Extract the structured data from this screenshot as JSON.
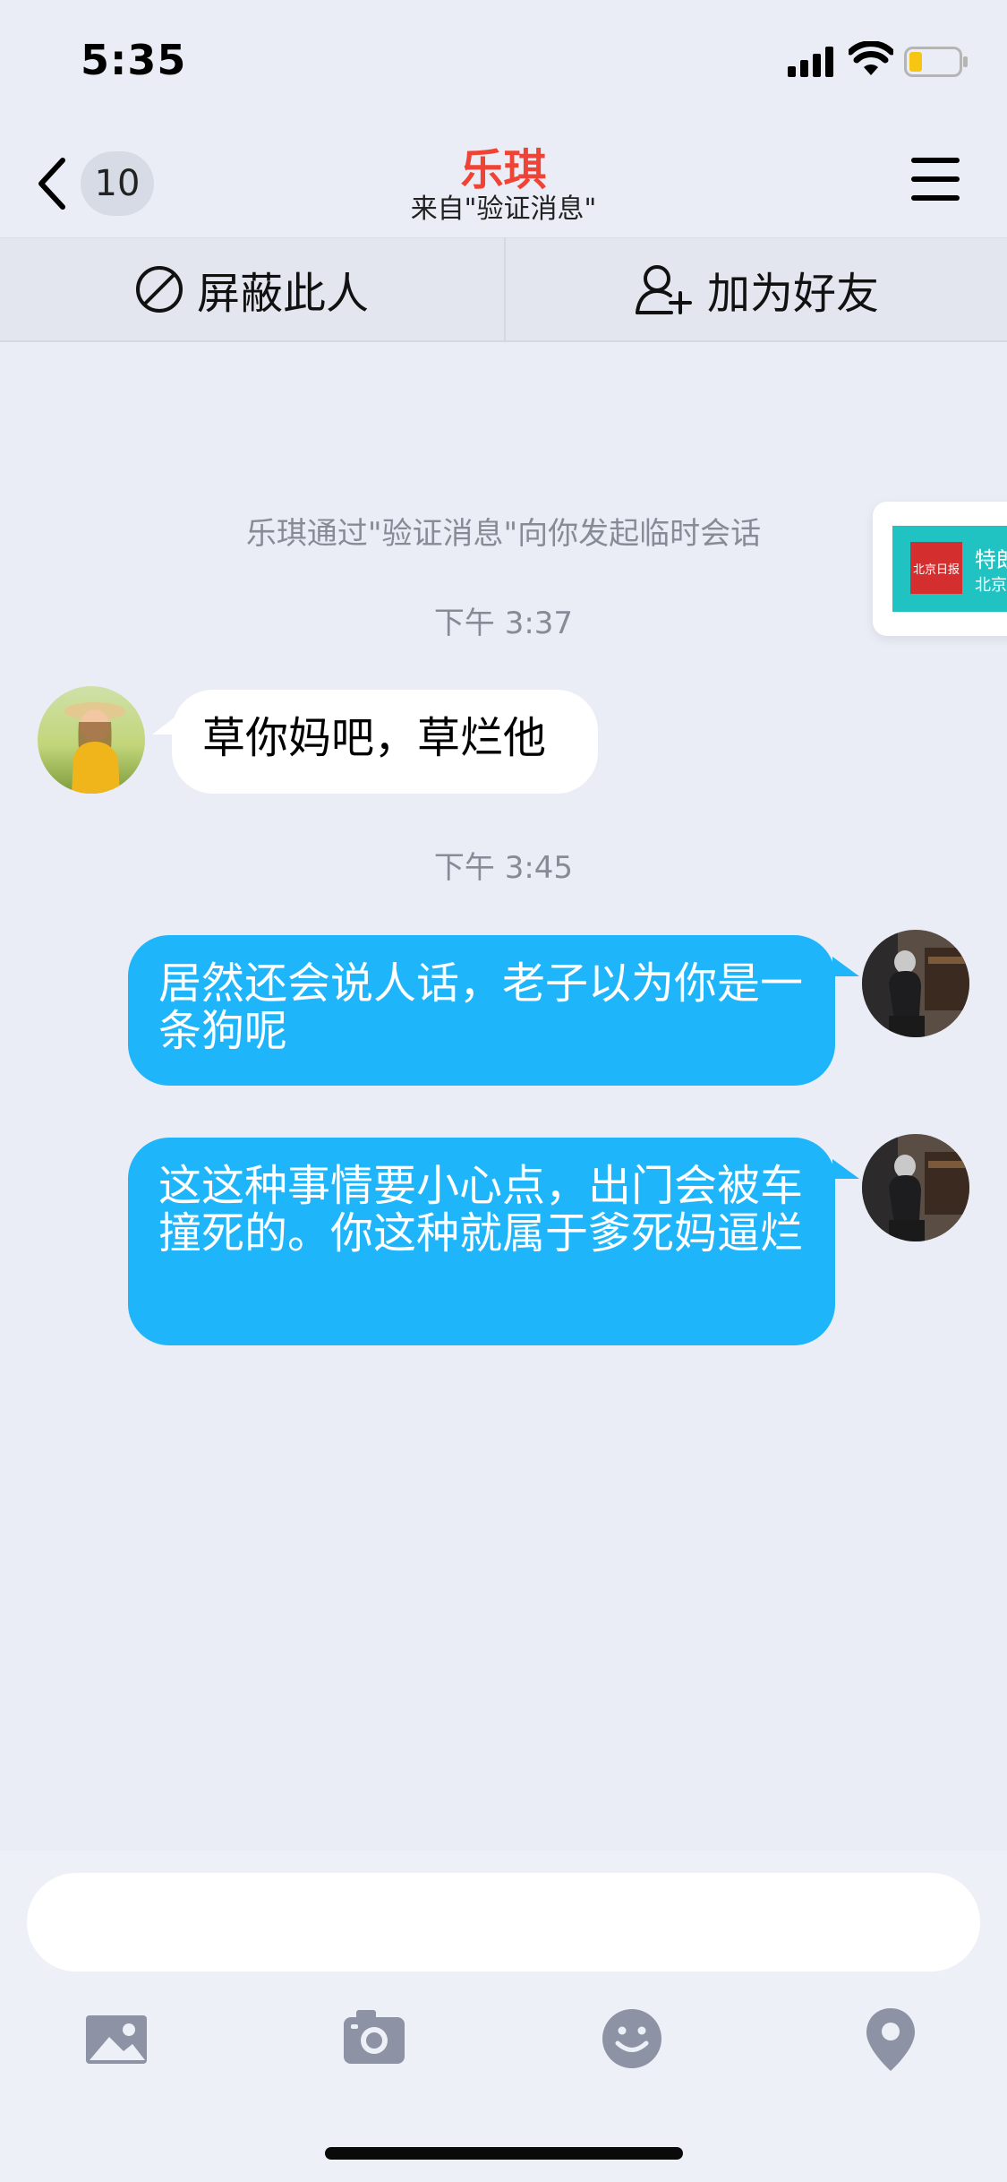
{
  "status_bar": {
    "time": "5:35"
  },
  "header": {
    "back_badge": "10",
    "contact_name": "乐琪",
    "contact_source": "来自\"验证消息\""
  },
  "actions": {
    "block_label": "屏蔽此人",
    "add_friend_label": "加为好友"
  },
  "chat": {
    "system_notice": "乐琪通过\"验证消息\"向你发起临时会话",
    "messages": [
      {
        "timestamp": "下午 3:37",
        "direction": "in",
        "text": "草你妈吧，草烂他"
      },
      {
        "timestamp": "下午 3:45",
        "direction": "out",
        "text": "居然还会说人话，老子以为你是一条狗呢"
      },
      {
        "direction": "out",
        "text": "这这种事情要小心点，出门会被车撞死的。你这种就属于爹死妈逼烂"
      }
    ]
  },
  "floating_card": {
    "logo_text": "北京日报",
    "title": "特朗",
    "subtitle": "北京"
  },
  "input": {
    "placeholder": ""
  },
  "toolbar_icons": [
    "image-icon",
    "camera-icon",
    "emoji-icon",
    "location-icon"
  ],
  "colors": {
    "accent_name": "#ef4335",
    "bubble_out": "#1eb5fb",
    "bubble_in": "#ffffff",
    "background": "#eaedf6"
  }
}
